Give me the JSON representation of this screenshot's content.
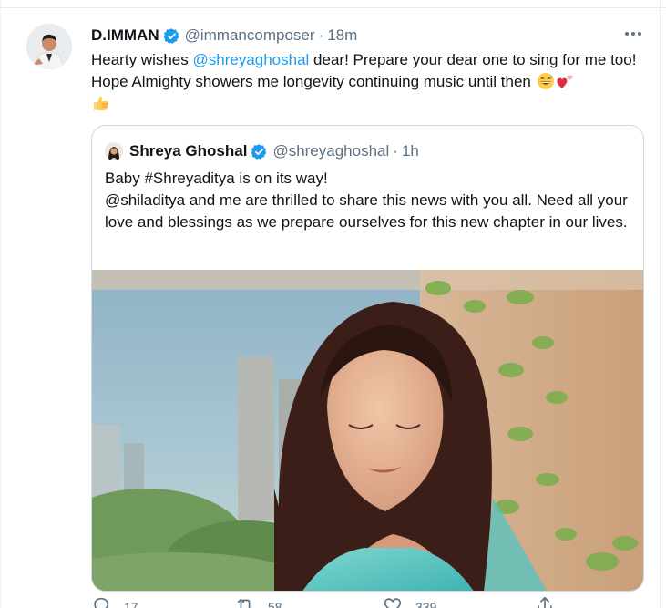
{
  "tweet": {
    "author_name": "D.IMMAN",
    "author_handle": "@immancomposer",
    "separator": "·",
    "time": "18m",
    "text_part1": "Hearty wishes ",
    "mention": "@shreyaghoshal",
    "text_part2": " dear! Prepare your dear one to sing for me too! Hope Almighty showers me longevity continuing music until then",
    "emojis": [
      "grinning-sweat-emoji",
      "two-hearts-emoji",
      "thumbs-up-emoji"
    ]
  },
  "quoted": {
    "author_name": "Shreya Ghoshal",
    "author_handle": "@shreyaghoshal",
    "separator": "·",
    "time": "1h",
    "line1": "Baby #Shreyaditya is on its way!",
    "line2": "@shiladitya and me are thrilled to share this news with you all. Need all your love and blessings as we prepare ourselves for this new chapter in our lives."
  },
  "actions": {
    "reply_count": "17",
    "retweet_count": "58",
    "like_count": "339"
  },
  "colors": {
    "accent": "#1d9bf0",
    "secondary_text": "#5b7083",
    "border": "#cfd9de"
  }
}
